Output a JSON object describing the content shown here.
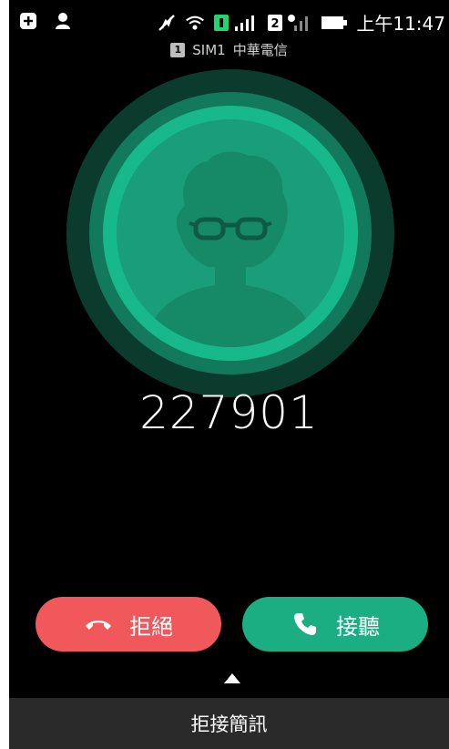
{
  "status_bar": {
    "time": "上午11:47",
    "sim1_label": "1",
    "sim2_label": "2",
    "icons": [
      "add-box-icon",
      "person-icon",
      "mute-icon",
      "wifi-icon",
      "sim1-signal-icon",
      "sim2-signal-icon",
      "battery-icon"
    ]
  },
  "sim_info": {
    "badge": "1",
    "name": "SIM1",
    "carrier": "中華電信"
  },
  "caller": {
    "number": "227901"
  },
  "actions": {
    "decline_label": "拒絕",
    "answer_label": "接聽",
    "reply_label": "拒接簡訊"
  },
  "colors": {
    "decline": "#f1585c",
    "answer": "#1bae82",
    "avatar_ring": "#17b98a",
    "background": "#000000"
  }
}
